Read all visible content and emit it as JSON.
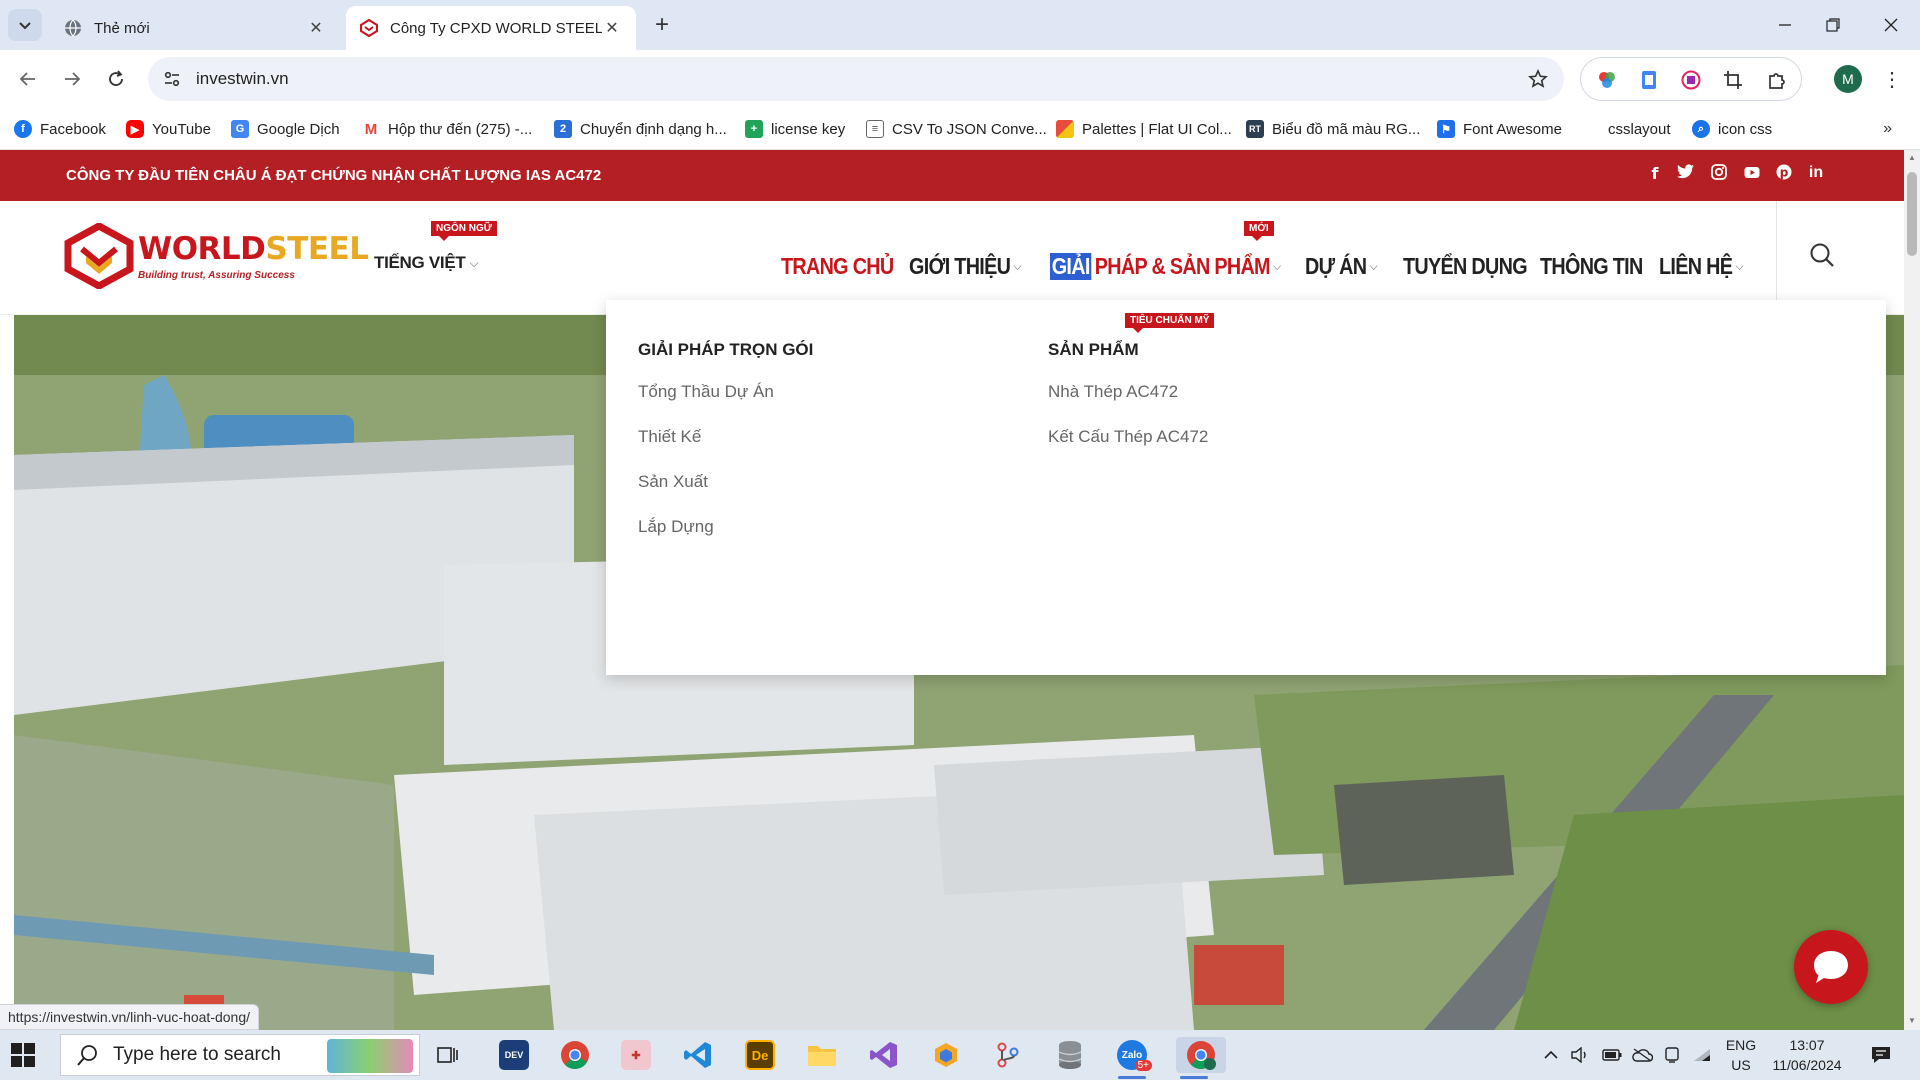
{
  "browser": {
    "tabs": [
      {
        "title": "Thẻ mới",
        "active": false
      },
      {
        "title": "Công Ty CPXD WORLD STEEL - V",
        "active": true
      }
    ],
    "url": "investwin.vn",
    "profile_initial": "M",
    "bookmarks": [
      {
        "label": "Facebook",
        "color": "#1877f2",
        "icon": "facebook-icon"
      },
      {
        "label": "YouTube",
        "color": "#ff0000",
        "icon": "youtube-icon"
      },
      {
        "label": "Google Dịch",
        "color": "#4285f4",
        "icon": "google-translate-icon"
      },
      {
        "label": "Hộp thư đến (275) -...",
        "color": "#ea4335",
        "icon": "gmail-icon"
      },
      {
        "label": "Chuyển định dạng h...",
        "color": "#2b6fd6",
        "icon": "convert-icon"
      },
      {
        "label": "license key",
        "color": "#22a35a",
        "icon": "sheets-icon"
      },
      {
        "label": "CSV To JSON Conve...",
        "color": "#555555",
        "icon": "document-icon"
      },
      {
        "label": "Palettes | Flat UI Col...",
        "color": "#e67e22",
        "icon": "palette-icon"
      },
      {
        "label": "Biểu đồ mã màu RG...",
        "color": "#2c3e50",
        "icon": "rt-icon"
      },
      {
        "label": "Font Awesome",
        "color": "#1f6feb",
        "icon": "flag-icon"
      },
      {
        "label": "csslayout",
        "color": "#ffffff",
        "icon": "blank-icon"
      },
      {
        "label": "icon css",
        "color": "#1a73e8",
        "icon": "search-icon"
      }
    ],
    "status_url": "https://investwin.vn/linh-vuc-hoat-dong/"
  },
  "site": {
    "announcement": "CÔNG TY ĐẦU TIÊN CHÂU Á ĐẠT CHỨNG NHẬN CHẤT LƯỢNG IAS AC472",
    "social": [
      {
        "icon": "facebook-icon",
        "glyph": "f"
      },
      {
        "icon": "twitter-icon",
        "glyph": "🐦"
      },
      {
        "icon": "instagram-icon",
        "glyph": "◎"
      },
      {
        "icon": "youtube-icon",
        "glyph": "▶"
      },
      {
        "icon": "pinterest-icon",
        "glyph": "p"
      },
      {
        "icon": "linkedin-icon",
        "glyph": "in"
      }
    ],
    "logo": {
      "word_a": "WORLD",
      "word_b": "STEEL",
      "tagline": "Building trust, Assuring Success"
    },
    "language": {
      "label": "TIẾNG VIỆT",
      "badge": "NGÔN NGỮ"
    },
    "menu": {
      "home": "TRANG CHỦ",
      "about": "GIỚI THIỆU",
      "solutions_highlight": "GIẢI",
      "solutions_rest": " PHÁP & SẢN PHẨM",
      "solutions_badge": "MỚI",
      "projects": "DỰ ÁN",
      "careers": "TUYỂN DỤNG",
      "news": "THÔNG TIN",
      "contact": "LIÊN HỆ"
    },
    "dropdown": {
      "col1": {
        "heading": "GIẢI PHÁP TRỌN GÓI",
        "links": [
          "Tổng Thầu Dự Án",
          "Thiết Kế",
          "Sản Xuất",
          "Lắp Dựng"
        ]
      },
      "col2": {
        "heading": "SẢN PHẨM",
        "badge": "TIÊU CHUẨN MỸ",
        "links": [
          "Nhà Thép AC472",
          "Kết Cấu Thép AC472"
        ]
      }
    }
  },
  "taskbar": {
    "search_placeholder": "Type here to search",
    "language_line1": "ENG",
    "language_line2": "US",
    "time": "13:07",
    "date": "11/06/2024",
    "zalo_badge": "5+"
  },
  "colors": {
    "brand_red": "#b41f24",
    "accent_red": "#c8161d",
    "highlight_blue": "#2d5fd3"
  }
}
